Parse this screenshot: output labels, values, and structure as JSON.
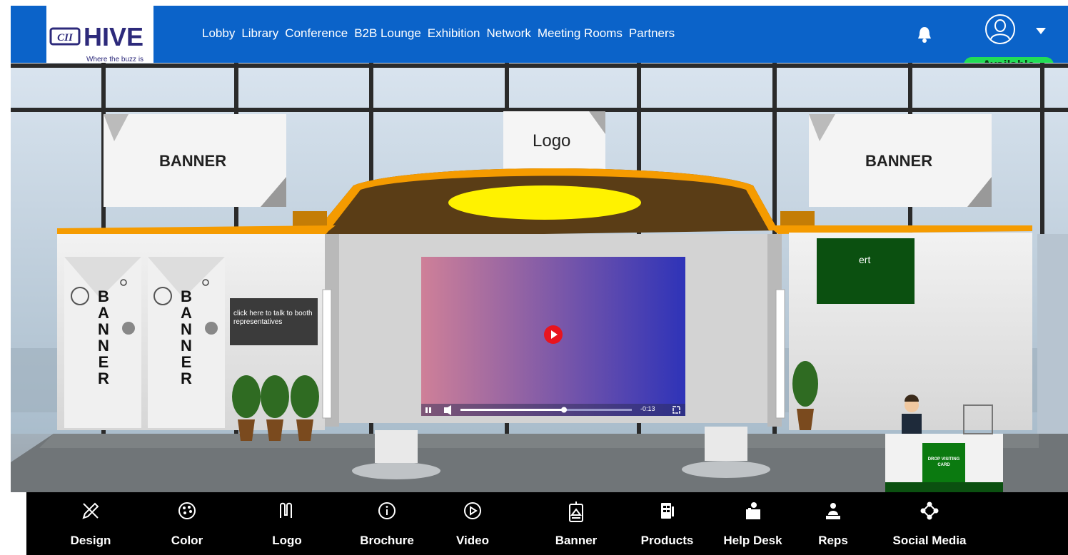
{
  "brand": {
    "cii": "CII",
    "name": "HIVE",
    "tagline": "Where the buzz is"
  },
  "nav": [
    "Lobby",
    "Library",
    "Conference",
    "B2B Lounge",
    "Exhibition",
    "Network",
    "Meeting Rooms",
    "Partners"
  ],
  "user": {
    "status": "Available"
  },
  "booth": {
    "banner_left": "BANNER",
    "banner_right": "BANNER",
    "logo": "Logo",
    "vertical_banner_1": "BANNER",
    "vertical_banner_2": "BANNER",
    "talk_prompt": "click here to talk to booth representatives",
    "green_board": "ert",
    "drop_card": "DROP VISITING CARD",
    "video_time": "-0:13"
  },
  "toolbar": [
    {
      "label": "Design",
      "icon": "design-icon"
    },
    {
      "label": "Color",
      "icon": "palette-icon"
    },
    {
      "label": "Logo",
      "icon": "logo-icon"
    },
    {
      "label": "Brochure",
      "icon": "info-icon"
    },
    {
      "label": "Video",
      "icon": "play-circle-icon"
    },
    {
      "label": "Banner",
      "icon": "banner-icon"
    },
    {
      "label": "Products",
      "icon": "products-icon"
    },
    {
      "label": "Help Desk",
      "icon": "help-desk-icon"
    },
    {
      "label": "Reps",
      "icon": "reps-icon"
    },
    {
      "label": "Social Media",
      "icon": "social-media-icon"
    }
  ],
  "colors": {
    "nav_bg": "#0b63c9",
    "status_green": "#22dd55",
    "accent_orange": "#f59b00",
    "board_green": "#0b5010"
  }
}
